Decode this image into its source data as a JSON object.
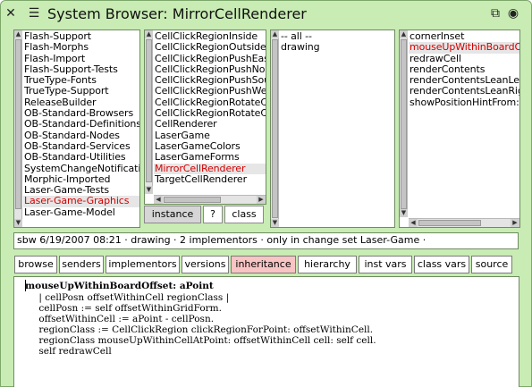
{
  "window": {
    "title": "System Browser: MirrorCellRenderer",
    "close_glyph": "✕",
    "menu_glyph": "☰",
    "collapse_glyph": "⧉",
    "expand_glyph": "◉"
  },
  "packages": {
    "items": [
      {
        "label": "Flash-Support"
      },
      {
        "label": "Flash-Morphs"
      },
      {
        "label": "Flash-Import"
      },
      {
        "label": "Flash-Support-Tests"
      },
      {
        "label": "TrueType-Fonts"
      },
      {
        "label": "TrueType-Support"
      },
      {
        "label": "ReleaseBuilder"
      },
      {
        "label": "OB-Standard-Browsers"
      },
      {
        "label": "OB-Standard-Definitions"
      },
      {
        "label": "OB-Standard-Nodes"
      },
      {
        "label": "OB-Standard-Services"
      },
      {
        "label": "OB-Standard-Utilities"
      },
      {
        "label": "SystemChangeNotification"
      },
      {
        "label": "Morphic-Imported"
      },
      {
        "label": "Laser-Game-Tests"
      },
      {
        "label": "Laser-Game-Graphics",
        "selected": true
      },
      {
        "label": "Laser-Game-Model"
      }
    ]
  },
  "classes": {
    "items": [
      {
        "label": "CellClickRegionInside"
      },
      {
        "label": "CellClickRegionOutside"
      },
      {
        "label": "CellClickRegionPushEast"
      },
      {
        "label": "CellClickRegionPushNorth"
      },
      {
        "label": "CellClickRegionPushSouth"
      },
      {
        "label": "CellClickRegionPushWest"
      },
      {
        "label": "CellClickRegionRotateClockwise"
      },
      {
        "label": "CellClickRegionRotateCounter"
      },
      {
        "label": "CellRenderer"
      },
      {
        "label": "LaserGame"
      },
      {
        "label": "LaserGameColors"
      },
      {
        "label": "LaserGameForms"
      },
      {
        "label": "MirrorCellRenderer",
        "selected": true
      },
      {
        "label": "TargetCellRenderer"
      }
    ],
    "switch": {
      "instance": "instance",
      "help": "?",
      "class": "class"
    }
  },
  "categories": {
    "items": [
      {
        "label": "-- all --"
      },
      {
        "label": "drawing"
      }
    ]
  },
  "methods": {
    "items": [
      {
        "label": "cornerInset"
      },
      {
        "label": "mouseUpWithinBoardOffset:",
        "selected": true
      },
      {
        "label": "redrawCell"
      },
      {
        "label": "renderContents"
      },
      {
        "label": "renderContentsLeanLeft"
      },
      {
        "label": "renderContentsLeanRight"
      },
      {
        "label": "showPositionHintFrom:"
      }
    ]
  },
  "info": {
    "text": "sbw 6/19/2007 08:21 · drawing · 2 implementors · only in change set Laser-Game  ·"
  },
  "buttons": {
    "browse": "browse",
    "senders": "senders",
    "implementors": "implementors",
    "versions": "versions",
    "inheritance": "inheritance",
    "hierarchy": "hierarchy",
    "inst_vars": "inst vars",
    "class_vars": "class vars",
    "source": "source"
  },
  "code": {
    "lines": [
      "mouseUpWithinBoardOffset: aPoint",
      "    | cellPosn offsetWithinCell regionClass |",
      "    cellPosn := self offsetWithinGridForm.",
      "    offsetWithinCell := aPoint - cellPosn.",
      "    regionClass := CellClickRegion clickRegionForPoint: offsetWithinCell.",
      "    regionClass mouseUpWithinCellAtPoint: offsetWithinCell cell: self cell.",
      "    self redrawCell"
    ]
  }
}
